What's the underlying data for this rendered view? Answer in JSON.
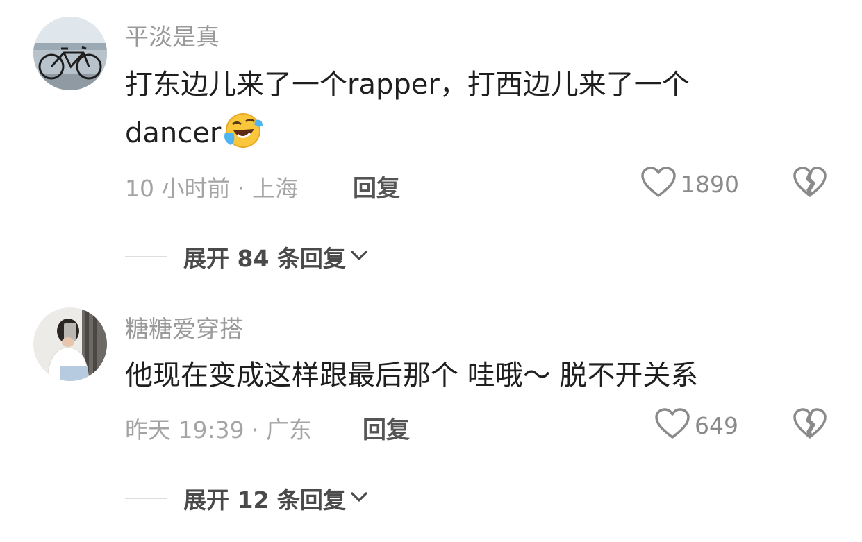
{
  "comments": [
    {
      "username": "平淡是真",
      "text_line1": "打东边儿来了一个rapper，打西边儿来了一个",
      "text_line2": "dancer",
      "emoji": "tears-of-joy-emoji",
      "time_location": "10 小时前 · 上海",
      "reply_label": "回复",
      "like_count": "1890",
      "expand_label": "展开 84 条回复"
    },
    {
      "username": "糖糖爱穿搭",
      "text": "他现在变成这样跟最后那个 哇哦～ 脱不开关系",
      "time_location": "昨天 19:39 · 广东",
      "reply_label": "回复",
      "like_count": "649",
      "expand_label": "展开 12 条回复"
    }
  ],
  "icons": {
    "like": "heart-outline-icon",
    "dislike": "broken-heart-icon",
    "expand": "chevron-down-icon"
  }
}
